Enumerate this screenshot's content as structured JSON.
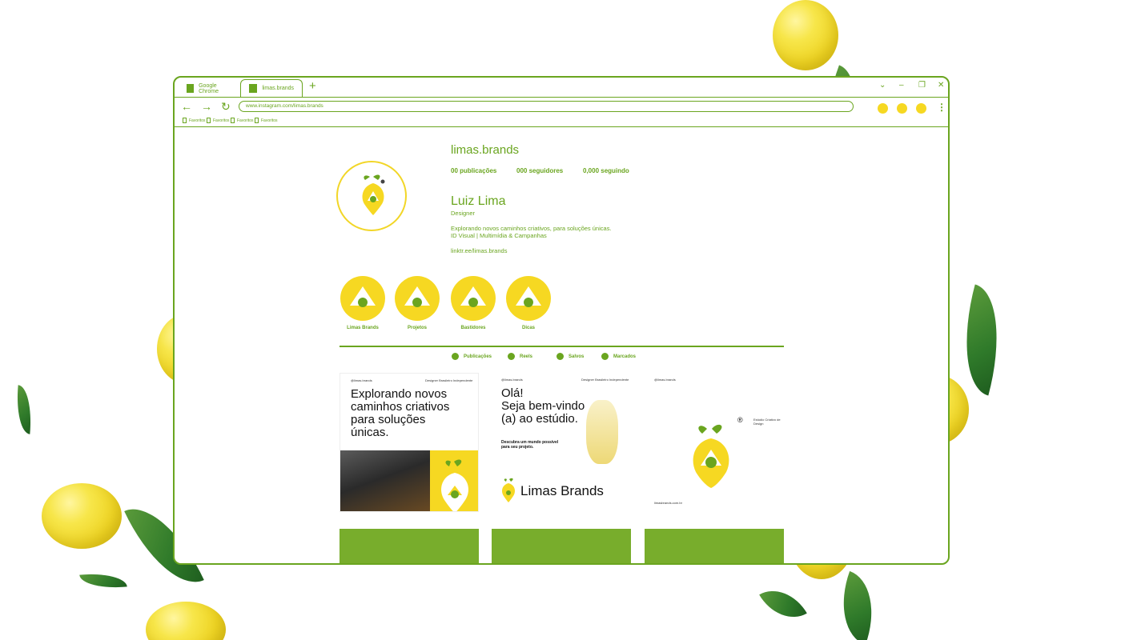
{
  "colors": {
    "accent": "#6aa51f",
    "lemon": "#f6d822",
    "post_block": "#78ad2c"
  },
  "browser": {
    "tabs": [
      {
        "label": "Google Chrome"
      },
      {
        "label": "limas.brands"
      }
    ],
    "new_tab_icon": "plus-icon",
    "url": "www.instagram.com/limas.brands",
    "bookmarks": [
      "Favoritos",
      "Favoritos",
      "Favoritos",
      "Favoritos"
    ]
  },
  "profile": {
    "username": "limas.brands",
    "posts": "00 publicações",
    "followers": "000 seguidores",
    "following": "0,000 seguindo",
    "name": "Luiz Lima",
    "role": "Designer",
    "bio_line1": "Explorando novos caminhos criativos, para soluções únicas.",
    "bio_line2": "ID Visual | Multimídia & Campanhas",
    "link": "linktr.ee/limas.brands"
  },
  "highlights": [
    "Limas Brands",
    "Projetos",
    "Bastidores",
    "Dicas"
  ],
  "profile_tabs": [
    "Publicações",
    "Reels",
    "Salvos",
    "Marcados"
  ],
  "posts": {
    "post1": {
      "handle": "@limas.brands",
      "tagline": "Designer Brasileiro Independente",
      "headline_l1": "Explorando novos",
      "headline_l2": "caminhos criativos",
      "headline_l3": "para soluções",
      "headline_l4": "únicas."
    },
    "post2": {
      "handle": "@limas.brands",
      "tagline": "Designer Brasileiro Independente",
      "headline_l1": "Olá!",
      "headline_l2": "Seja bem-vindo",
      "headline_l3": "(a) ao estúdio.",
      "sub_l1": "Descubra um mundo possível",
      "sub_l2": "para seu projeto.",
      "brand": "Limas Brands"
    },
    "post3": {
      "handle": "@limas.brands",
      "side_label": "Estúdio Criativo de Design",
      "footer": "limasbrands.com.br"
    }
  }
}
